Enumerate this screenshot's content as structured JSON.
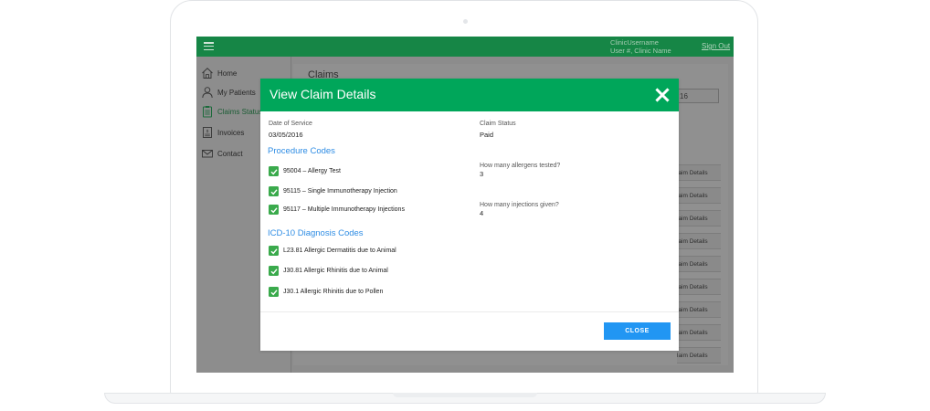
{
  "header": {
    "user_line1": "ClinicUsername",
    "user_line2": "User #, Clinic Name",
    "sign_out": "Sign Out"
  },
  "sidebar": {
    "items": [
      {
        "label": "Home",
        "icon": "home-icon"
      },
      {
        "label": "My Patients",
        "icon": "user-icon"
      },
      {
        "label": "Claims Status",
        "icon": "clipboard-icon",
        "active": true
      },
      {
        "label": "Invoices",
        "icon": "invoice-icon"
      },
      {
        "label": "Contact",
        "icon": "envelope-icon"
      }
    ]
  },
  "background": {
    "title": "Claims",
    "search_value": "16",
    "row_action_label": "laim Details",
    "row_count": 9
  },
  "modal": {
    "title": "View Claim Details",
    "date_of_service_label": "Date of Service",
    "date_of_service_value": "03/05/2016",
    "claim_status_label": "Claim Status",
    "claim_status_value": "Paid",
    "procedure_heading": "Procedure Codes",
    "procedures": [
      "95004 – Allergy Test",
      "95115 – Single Immunotherapy Injection",
      "95117 – Multiple Immunotherapy Injections"
    ],
    "allergens_label": "How many allergens tested?",
    "allergens_value": "3",
    "injections_label": "How many injections given?",
    "injections_value": "4",
    "icd_heading": "ICD-10 Diagnosis Codes",
    "diagnoses": [
      "L23.81 Allergic Dermatitis due to Animal",
      "J30.81 Allergic Rhinitis due to Animal",
      "J30.1 Allergic Rhinitis due to Pollen"
    ],
    "close_label": "CLOSE"
  },
  "colors": {
    "header_green": "#168646",
    "modal_green": "#00a65a",
    "checkbox_green": "#3aaa4c",
    "link_blue": "#2f8de4",
    "button_blue": "#2196f3"
  }
}
